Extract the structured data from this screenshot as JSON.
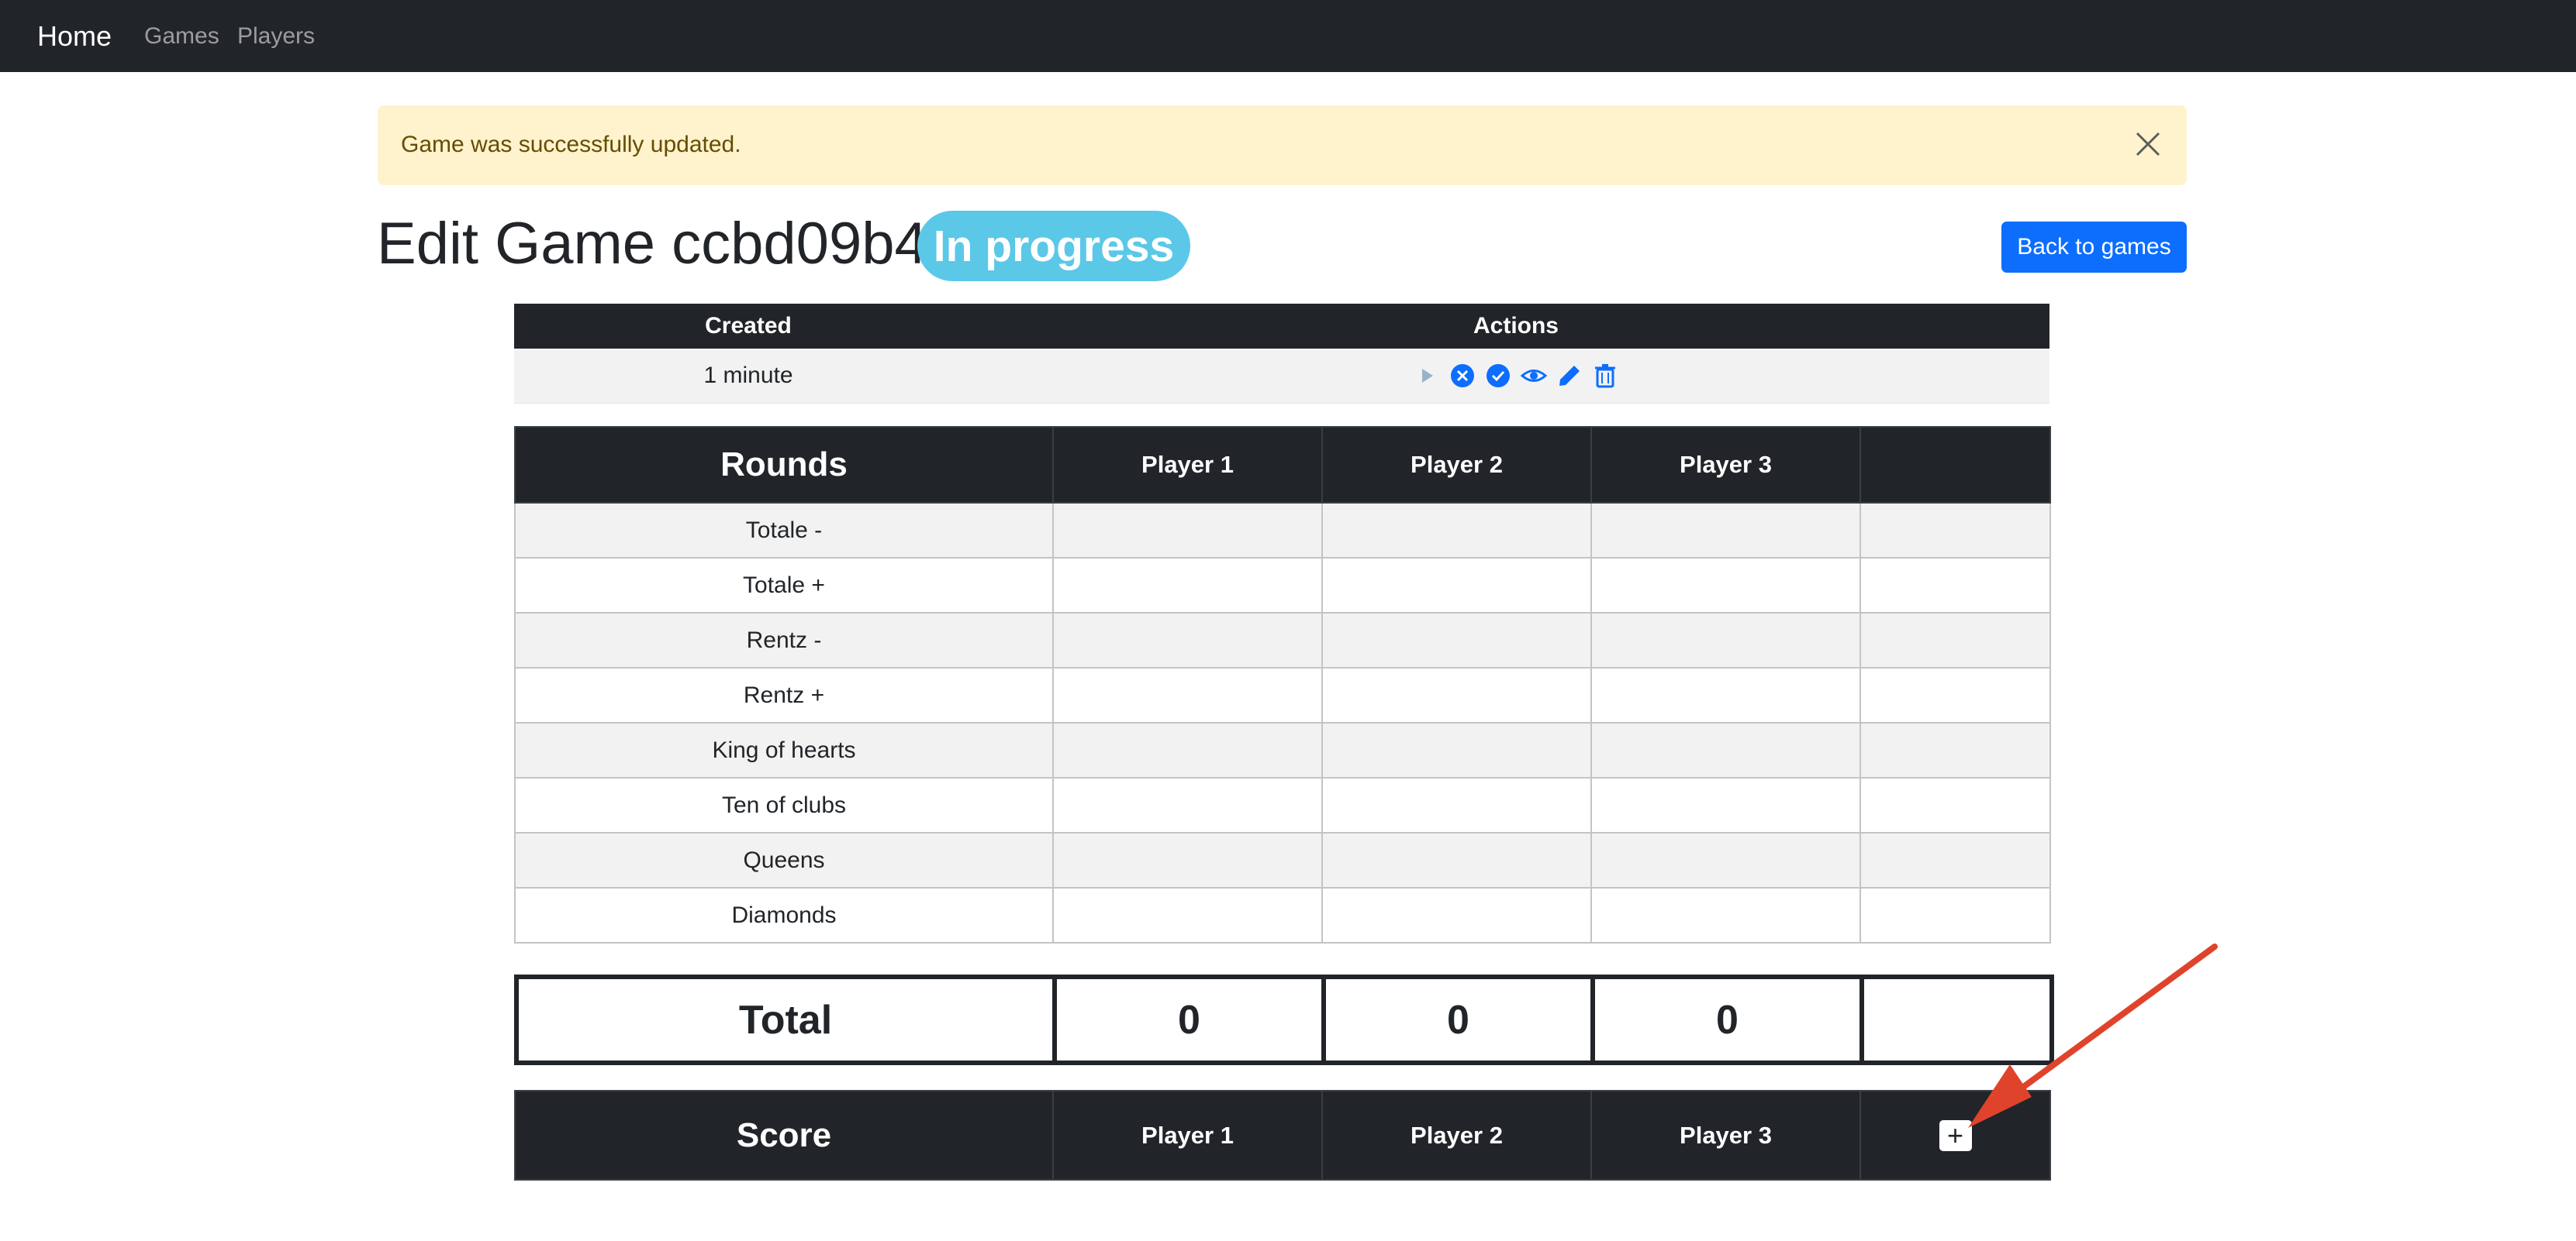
{
  "navbar": {
    "brand": "Home",
    "links": [
      "Games",
      "Players"
    ]
  },
  "alert": {
    "message": "Game was successfully updated."
  },
  "header": {
    "title": "Edit Game ccbd09b4",
    "status": "In progress",
    "back_button": "Back to games"
  },
  "info_table": {
    "columns": [
      "Created",
      "Actions"
    ],
    "created": "1 minute",
    "actions": [
      "play-icon",
      "cancel-icon",
      "complete-icon",
      "view-icon",
      "edit-icon",
      "delete-icon"
    ]
  },
  "rounds_table": {
    "headers": [
      "Rounds",
      "Player 1",
      "Player 2",
      "Player 3",
      ""
    ],
    "rows": [
      "Totale -",
      "Totale +",
      "Rentz -",
      "Rentz +",
      "King of hearts",
      "Ten of clubs",
      "Queens",
      "Diamonds"
    ]
  },
  "total_row": {
    "label": "Total",
    "values": [
      "0",
      "0",
      "0",
      ""
    ]
  },
  "score_table": {
    "headers": [
      "Score",
      "Player 1",
      "Player 2",
      "Player 3"
    ],
    "add_button": "+"
  },
  "colors": {
    "navbar": "#212529",
    "alert_bg": "#fff3cd",
    "badge": "#5bc8e8",
    "primary": "#0d6efd",
    "annotation_arrow": "#e0432b"
  }
}
